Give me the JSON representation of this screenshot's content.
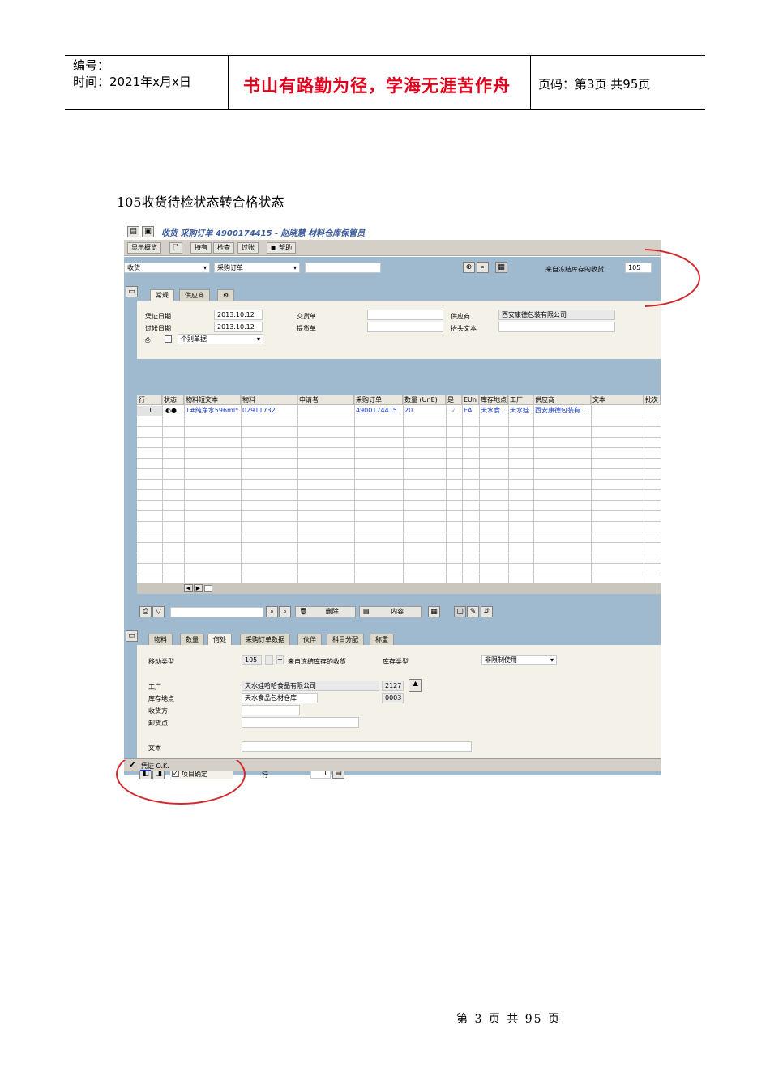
{
  "header": {
    "number_label": "编号：",
    "time": "时间：2021年x月x日",
    "motto": "书山有路勤为径，学海无涯苦作舟",
    "page": "页码：第3页  共95页"
  },
  "caption": "105收货待检状态转合格状态",
  "footer": "第 3 页 共 95 页",
  "sap": {
    "title": "收货 采购订单 4900174415 - 赵晓慧 材料仓库保管员",
    "toolbar": [
      "显示概览",
      "持有",
      "检查",
      "过账",
      "帮助"
    ],
    "action": "收货",
    "reference": "采购订单",
    "movement_label": "来自冻结库存的收货",
    "movement_type": "105",
    "header_tabs": [
      "常规",
      "供应商"
    ],
    "general": {
      "doc_date_label": "凭证日期",
      "doc_date": "2013.10.12",
      "post_date_label": "过帐日期",
      "post_date": "2013.10.12",
      "delivery_note_label": "交货单",
      "bill_of_lading_label": "提货单",
      "vendor_label": "供应商",
      "vendor": "西安康德包装有限公司",
      "header_text_label": "抬头文本",
      "individual_slip": "个别单据"
    },
    "table": {
      "columns": [
        "行",
        "状态",
        "物料短文本",
        "物料",
        "申请者",
        "采购订单",
        "数量 (UnE)",
        "是",
        "EUn",
        "库存地点",
        "工厂",
        "供应商",
        "文本",
        "批次"
      ],
      "rows": [
        [
          "1",
          "",
          "1#纯净水596ml*...",
          "02911732",
          "",
          "4900174415",
          "20",
          "",
          "EA",
          "天水食...",
          "天水娃...",
          "西安康德包装有...",
          "",
          ""
        ]
      ]
    },
    "item_buttons": {
      "delete": "删除",
      "content": "内容"
    },
    "detail_tabs": [
      "物料",
      "数量",
      "何处",
      "采购订单数据",
      "伙伴",
      "科目分配",
      "称重"
    ],
    "detail": {
      "movement_type_label": "移动类型",
      "movement_type": "105",
      "movement_desc": "来自冻结库存的收货",
      "stock_type_label": "库存类型",
      "stock_type": "非限制使用",
      "plant_label": "工厂",
      "plant_name": "天水娃哈哈食品有限公司",
      "plant_code": "2127",
      "sloc_label": "库存地点",
      "sloc_name": "天水食品包材仓库",
      "sloc_code": "0003",
      "recipient_label": "收货方",
      "unload_label": "卸货点",
      "text_label": "文本"
    },
    "footer_bar": {
      "item_ok": "项目确定",
      "line_label": "行",
      "line_value": "1"
    },
    "status": "凭证 O.K."
  }
}
